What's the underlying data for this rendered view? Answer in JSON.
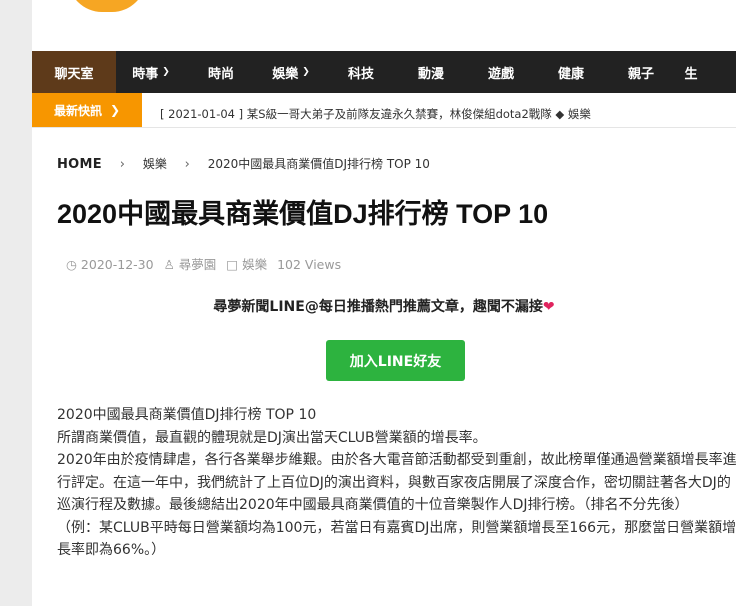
{
  "nav": {
    "items": [
      {
        "label": "聊天室",
        "caret": false,
        "active": true
      },
      {
        "label": "時事",
        "caret": true
      },
      {
        "label": "時尚",
        "caret": false
      },
      {
        "label": "娛樂",
        "caret": true
      },
      {
        "label": "科技",
        "caret": false
      },
      {
        "label": "動漫",
        "caret": false
      },
      {
        "label": "遊戲",
        "caret": false
      },
      {
        "label": "健康",
        "caret": false
      },
      {
        "label": "親子",
        "caret": false
      },
      {
        "label": "生",
        "caret": false
      }
    ]
  },
  "ticker": {
    "label": "最新快訊",
    "text": "[ 2021-01-04 ]   某S級一哥大弟子及前隊友違永久禁賽，林俊傑組dota2戰隊   ◆  娛樂"
  },
  "breadcrumb": {
    "home": "HOME",
    "category": "娛樂",
    "current": "2020中國最具商業價值DJ排行榜 TOP 10"
  },
  "article": {
    "title": "2020中國最具商業價值DJ排行榜 TOP 10",
    "date": "2020-12-30",
    "author": "尋夢園",
    "category": "娛樂",
    "views": "102 Views",
    "promo": "尋夢新聞LINE@每日推播熱門推薦文章，趣聞不漏接",
    "line_button": "加入LINE好友",
    "paragraphs": [
      "2020中國最具商業價值DJ排行榜 TOP 10",
      "所謂商業價值，最直觀的體現就是DJ演出當天CLUB營業額的增長率。",
      "2020年由於疫情肆虐，各行各業舉步維艱。由於各大電音節活動都受到重創，故此榜單僅通過營業額增長率進行評定。在這一年中，我們統計了上百位DJ的演出資料，與數百家夜店開展了深度合作，密切關註著各大DJ的巡演行程及數據。最後總結出2020年中國最具商業價值的十位音樂製作人DJ排行榜。（排名不分先後）",
      "（例：某CLUB平時每日營業額均為100元，若當日有嘉賓DJ出席，則營業額增長至166元，那麼當日營業額增長率即為66%。）"
    ]
  },
  "colors": {
    "nav_bg": "#222222",
    "nav_active": "#5e3a1a",
    "ticker_label": "#f79600",
    "line_green": "#2db33f"
  }
}
